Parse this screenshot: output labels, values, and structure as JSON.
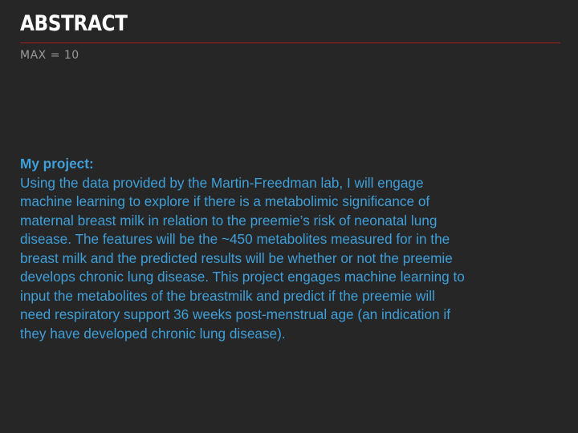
{
  "slide": {
    "title": "ABSTRACT",
    "subtitle": "MAX = 10",
    "body_heading": "My project:",
    "body_lines": [
      "Using the data provided by the Martin-Freedman lab, I will engage",
      "machine learning to explore if there is a metabolimic significance of",
      "maternal breast milk in relation to the preemie’s risk of neonatal lung",
      "disease. The features will be the ~450 metabolites measured for in the",
      "breast milk and the predicted results will be whether or not the preemie",
      "develops chronic lung disease.  This project engages machine learning to",
      "input the metabolites of the breastmilk and predict if the preemie will",
      "need respiratory support 36 weeks post-menstrual age (an indication if",
      "they have developed chronic lung disease)."
    ]
  },
  "colors": {
    "background": "#262626",
    "title": "#ffffff",
    "rule": "#a61e1e",
    "subtitle": "#9a9a9a",
    "body": "#3f9fd8"
  }
}
